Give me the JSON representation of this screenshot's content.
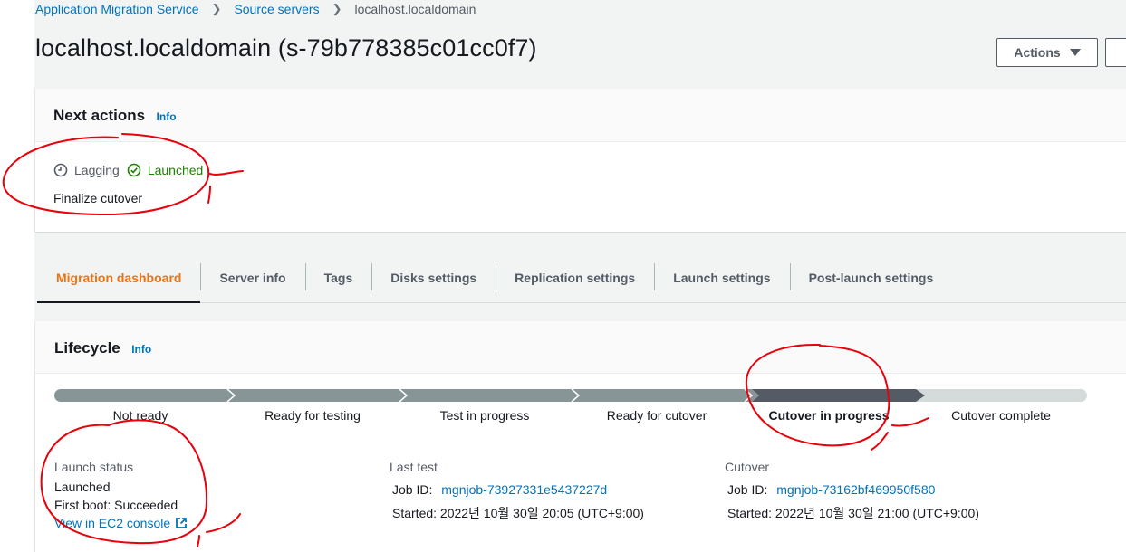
{
  "breadcrumb": {
    "items": [
      "Application Migration Service",
      "Source servers"
    ],
    "current": "localhost.localdomain"
  },
  "page": {
    "title": "localhost.localdomain (s-79b778385c01cc0f7)"
  },
  "header_actions": {
    "actions_label": "Actions"
  },
  "next_actions": {
    "title": "Next actions",
    "info": "Info",
    "status_lagging": "Lagging",
    "status_launched": "Launched",
    "action": "Finalize cutover"
  },
  "tabs": [
    {
      "label": "Migration dashboard",
      "active": true
    },
    {
      "label": "Server info"
    },
    {
      "label": "Tags"
    },
    {
      "label": "Disks settings"
    },
    {
      "label": "Replication settings"
    },
    {
      "label": "Launch settings"
    },
    {
      "label": "Post-launch settings"
    }
  ],
  "lifecycle": {
    "title": "Lifecycle",
    "info": "Info",
    "steps": [
      "Not ready",
      "Ready for testing",
      "Test in progress",
      "Ready for cutover",
      "Cutover in progress",
      "Cutover complete"
    ],
    "current_step": "Cutover in progress",
    "launch_status": {
      "title": "Launch status",
      "status": "Launched",
      "first_boot": "First boot: Succeeded",
      "ec2_link": "View in EC2 console"
    },
    "last_test": {
      "title": "Last test",
      "job_label": "Job ID:",
      "job_id": "mgnjob-73927331e5437227d",
      "started": "Started: 2022년 10월 30일 20:05 (UTC+9:00)"
    },
    "cutover": {
      "title": "Cutover",
      "job_label": "Job ID:",
      "job_id": "mgnjob-73162bf469950f580",
      "started": "Started: 2022년 10월 30일 21:00 (UTC+9:00)"
    }
  },
  "colors": {
    "link": "#0073bb",
    "active_tab": "#ec7211",
    "success": "#1d8102",
    "step_done": "#879596",
    "step_current": "#545b64",
    "step_pending": "#d5dbdb",
    "annotation": "#e8000b"
  }
}
